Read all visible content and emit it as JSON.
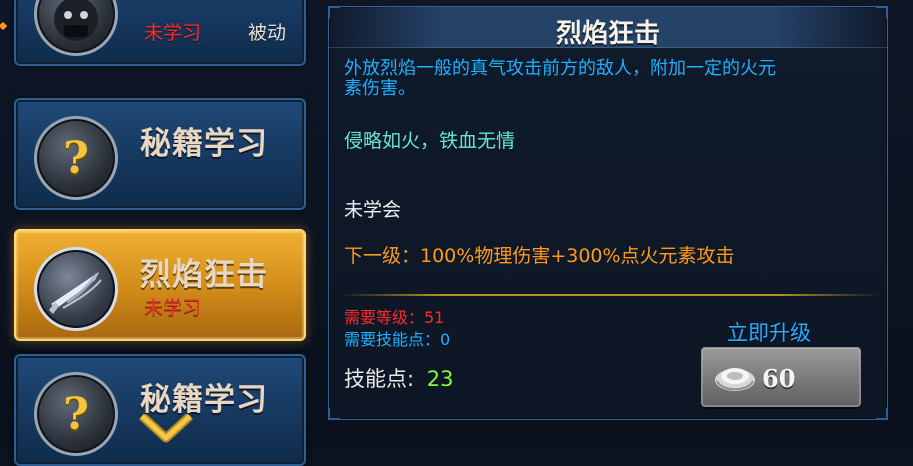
{
  "skill_list": {
    "items": [
      {
        "title": "",
        "status": "未学习",
        "type": "被动",
        "icon": "mask-icon",
        "state": "partial-top"
      },
      {
        "title": "秘籍学习",
        "status": "",
        "type": "",
        "icon": "question-icon",
        "state": "normal"
      },
      {
        "title": "烈焰狂击",
        "status": "未学习",
        "type": "",
        "icon": "blade-icon",
        "state": "selected"
      },
      {
        "title": "秘籍学习",
        "status": "",
        "type": "",
        "icon": "question-icon",
        "state": "partial-bottom"
      }
    ]
  },
  "detail": {
    "title": "烈焰狂击",
    "description": "外放烈焰一般的真气攻击前方的敌人，附加一定的火元素伤害。",
    "motto": "侵略如火，铁血无情",
    "learn_state": "未学会",
    "next_level": "下一级：100%物理伤害+300%点火元素攻击",
    "required_level": "需要等级：51",
    "required_skill_points": "需要技能点：0",
    "skill_points_label": "技能点:",
    "skill_points_value": "23",
    "upgrade_label": "立即升级",
    "upgrade_cost": "60"
  },
  "colors": {
    "selected_gold": "#d08b18",
    "card_blue": "#173b63",
    "status_red": "#ff2a2a",
    "desc_blue": "#1fb1ff",
    "motto_teal": "#66e6d0",
    "next_orange": "#ff9a1a",
    "points_green": "#7dff3b"
  }
}
